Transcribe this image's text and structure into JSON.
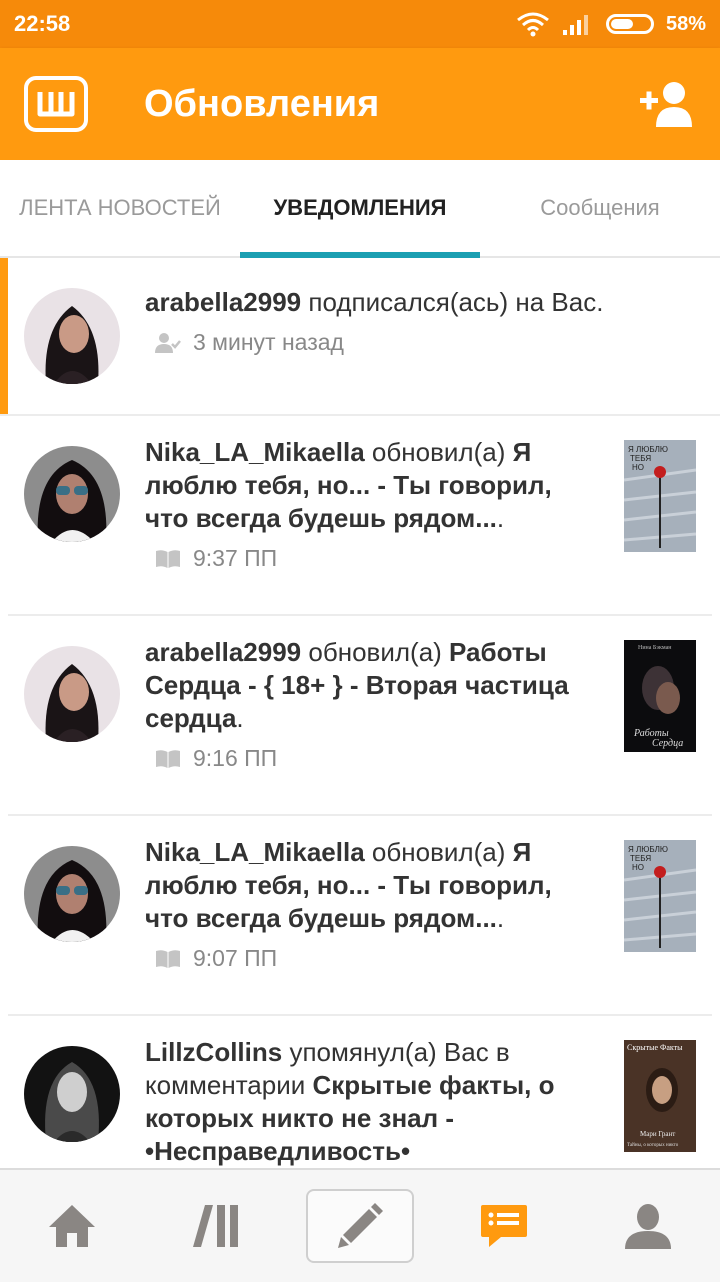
{
  "status_bar": {
    "time": "22:58",
    "battery": "58%",
    "battery_level": 0.58
  },
  "app_bar": {
    "title": "Обновления",
    "logo_icon": "wattpad-w-icon",
    "action_icon": "add-user-icon"
  },
  "colors": {
    "accent": "#ff9a0f",
    "status": "#f68a0a",
    "tab_indicator": "#1b9fb2",
    "chat_active": "#ff9a0f"
  },
  "tabs": [
    {
      "label": "ЛЕНТА НОВОСТЕЙ"
    },
    {
      "label": "УВЕДОМЛЕНИЯ",
      "active": true
    },
    {
      "label": "Сообщения"
    }
  ],
  "notifications": [
    {
      "user": "arabella2999",
      "action": " подписался(ась) на Вас.",
      "title": "",
      "tail": "",
      "time": "3 минут назад",
      "icon": "follow-icon"
    },
    {
      "user": "Nika_LA_Mikaella",
      "action": " обновил(а) ",
      "title": "Я люблю тебя, но... - Ты говорил, что всегда будешь рядом...",
      "tail": ".",
      "time": "9:37 ПП",
      "icon": "book-icon"
    },
    {
      "user": "arabella2999",
      "action": " обновил(а) ",
      "title": "Работы Сердца - { 18+ } - Вторая частица сердца",
      "tail": ".",
      "time": "9:16 ПП",
      "icon": "book-icon"
    },
    {
      "user": "Nika_LA_Mikaella",
      "action": " обновил(а) ",
      "title": "Я люблю тебя, но... - Ты говорил, что всегда будешь рядом...",
      "tail": ".",
      "time": "9:07 ПП",
      "icon": "book-icon"
    },
    {
      "user": "LillzCollins",
      "action": " упомянул(а) Вас в комментарии ",
      "title": "Скрытые факты, о которых никто не знал - •Несправедливость•",
      "tail": "",
      "time": "",
      "icon": ""
    }
  ],
  "covers": {
    "love": {
      "line1": "Я ЛЮБЛЮ",
      "line2": "ТЕБЯ",
      "line3": "НО"
    },
    "hearts": {
      "top": "Нина Бэкман",
      "bottom1": "Работы",
      "bottom2": "Сердца"
    },
    "facts": {
      "top": "Скрытые Факты",
      "author": "Мари Грант",
      "sub": "Тайны, о которых никто"
    }
  },
  "bottom_nav": [
    "home-icon",
    "library-icon",
    "write-icon",
    "notifications-chat-icon",
    "profile-icon"
  ]
}
